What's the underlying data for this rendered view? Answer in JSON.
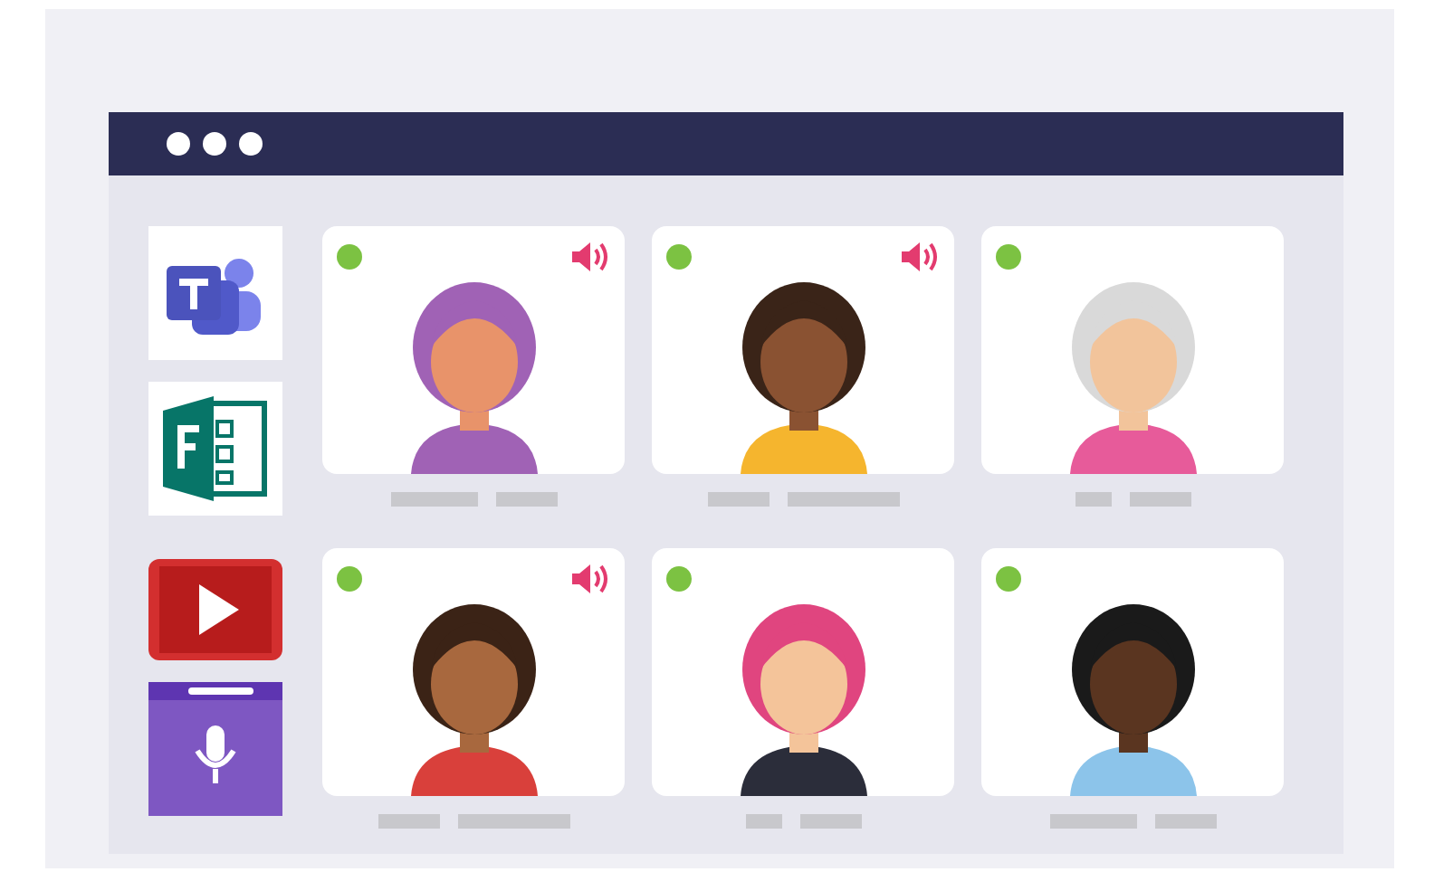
{
  "window": {
    "controls": [
      {
        "kind": "dot"
      },
      {
        "kind": "dot"
      },
      {
        "kind": "dot"
      }
    ]
  },
  "sidebar": {
    "apps": [
      {
        "kind": "chat"
      },
      {
        "kind": "forms"
      },
      {
        "kind": "video"
      },
      {
        "kind": "voice"
      }
    ]
  },
  "participants": [
    {
      "online": true,
      "speaking": true
    },
    {
      "online": true,
      "speaking": true
    },
    {
      "online": true,
      "speaking": false
    },
    {
      "online": true,
      "speaking": true
    },
    {
      "online": true,
      "speaking": false
    },
    {
      "online": true,
      "speaking": false
    }
  ]
}
